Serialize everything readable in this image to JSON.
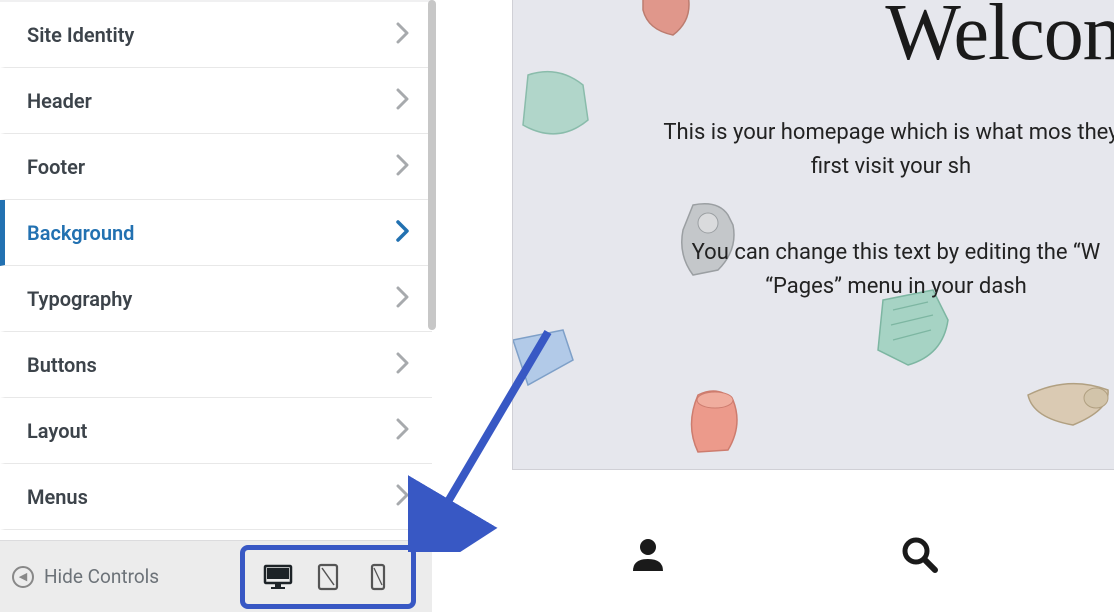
{
  "sidebar": {
    "items": [
      {
        "label": "Site Identity",
        "active": false
      },
      {
        "label": "Header",
        "active": false
      },
      {
        "label": "Footer",
        "active": false
      },
      {
        "label": "Background",
        "active": true
      },
      {
        "label": "Typography",
        "active": false
      },
      {
        "label": "Buttons",
        "active": false
      },
      {
        "label": "Layout",
        "active": false
      },
      {
        "label": "Menus",
        "active": false
      }
    ],
    "footer": {
      "hide_controls_label": "Hide Controls",
      "devices": [
        "desktop",
        "tablet",
        "mobile"
      ],
      "device_active": "desktop"
    }
  },
  "preview": {
    "title": "Welcom",
    "paragraph1": "This is your homepage which is what mos they first visit your sh",
    "paragraph2": "You can change this text by editing the “W “Pages” menu in your dash"
  }
}
